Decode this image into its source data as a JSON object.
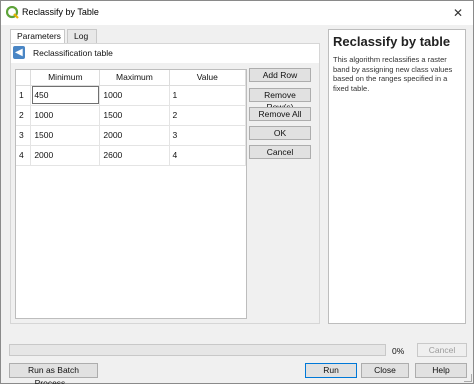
{
  "window": {
    "title": "Reclassify by Table",
    "close_glyph": "✕"
  },
  "tabs": [
    {
      "label": "Parameters"
    },
    {
      "label": "Log"
    }
  ],
  "parameters": {
    "section_label": "Reclassification table",
    "back_glyph": "◀"
  },
  "table": {
    "columns": [
      "Minimum",
      "Maximum",
      "Value"
    ],
    "rows": [
      {
        "num": "1",
        "min": "450",
        "max": "1000",
        "value": "1"
      },
      {
        "num": "2",
        "min": "1000",
        "max": "1500",
        "value": "2"
      },
      {
        "num": "3",
        "min": "1500",
        "max": "2000",
        "value": "3"
      },
      {
        "num": "4",
        "min": "2000",
        "max": "2600",
        "value": "4"
      }
    ]
  },
  "side_buttons": {
    "add_row": "Add Row",
    "remove_rows": "Remove Row(s)",
    "remove_all": "Remove All",
    "ok": "OK",
    "cancel": "Cancel"
  },
  "help": {
    "title": "Reclassify by table",
    "text": "This algorithm reclassifies a raster band by assigning new class values based on the ranges specified in a fixed table."
  },
  "progress": {
    "percent_text": "0%",
    "value": 0,
    "cancel_label": "Cancel"
  },
  "footer": {
    "batch_label": "Run as Batch Process...",
    "run_label": "Run",
    "close_label": "Close",
    "help_label": "Help"
  },
  "colors": {
    "accent": "#0078d7",
    "back_button": "#4a86c5",
    "logo_green": "#5ea33a"
  },
  "icons": {
    "app": "qgis-logo-icon",
    "back": "back-arrow-icon",
    "close": "close-icon"
  }
}
